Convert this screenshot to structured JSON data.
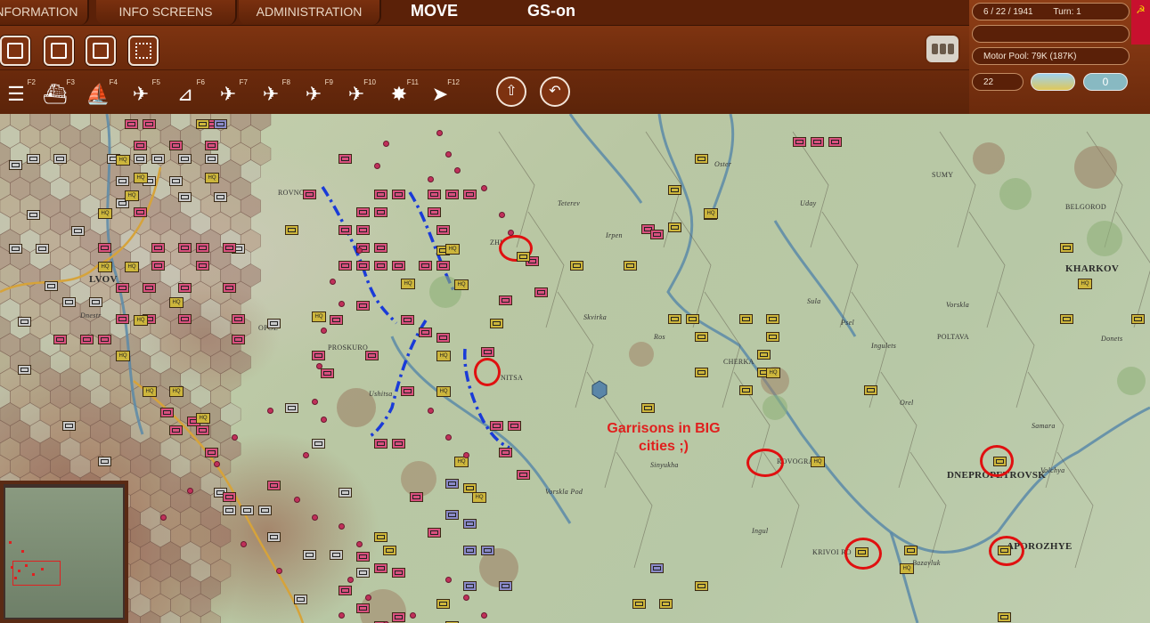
{
  "tabs": [
    {
      "label": "INFORMATION"
    },
    {
      "label": "INFO SCREENS"
    },
    {
      "label": "ADMINISTRATION"
    }
  ],
  "modes": {
    "move": "MOVE",
    "gs": "GS-on"
  },
  "toolbar_top": [
    {
      "icon": "unit-card-icon"
    },
    {
      "icon": "list-icon"
    },
    {
      "icon": "save-icon"
    },
    {
      "icon": "grid-icon"
    }
  ],
  "fkeys": [
    {
      "key": "F2",
      "icon": "rail-icon"
    },
    {
      "key": "F3",
      "icon": "battleship-icon"
    },
    {
      "key": "F4",
      "icon": "transport-ship-icon"
    },
    {
      "key": "F5",
      "icon": "air-recon-icon"
    },
    {
      "key": "F6",
      "icon": "artillery-icon"
    },
    {
      "key": "F7",
      "icon": "air-transfer-icon"
    },
    {
      "key": "F8",
      "icon": "air-interdiction-icon"
    },
    {
      "key": "F9",
      "icon": "paradrop-icon"
    },
    {
      "key": "F10",
      "icon": "air-bomb-icon"
    },
    {
      "key": "F11",
      "icon": "explosion-icon"
    },
    {
      "key": "F12",
      "icon": "end-turn-icon"
    }
  ],
  "actions": [
    {
      "icon": "upload-icon"
    },
    {
      "icon": "undo-icon"
    }
  ],
  "info": {
    "date": "6 / 22 / 1941",
    "turn": "Turn: 1",
    "blank": "",
    "motor_pool": "Motor Pool:  79K (187K)",
    "level": "22",
    "toggle_value": "0"
  },
  "colors": {
    "soviet": "#d8507e",
    "axis": "#c9c9c9",
    "allied_hq": "#cdb63c",
    "highlight": "#e01010",
    "bar": "#7a300f"
  },
  "map": {
    "towns": [
      {
        "name": "LVOV",
        "big": true
      },
      {
        "name": "ROVNO",
        "big": false
      },
      {
        "name": "PROSKURO",
        "big": false
      },
      {
        "name": "ZHI",
        "big": false
      },
      {
        "name": "NITSA",
        "big": false
      },
      {
        "name": "CHERKA",
        "big": false
      },
      {
        "name": "ROVOGRA",
        "big": false
      },
      {
        "name": "KRIVOI RO",
        "big": false
      },
      {
        "name": "DNEPROPETROVSK",
        "big": true
      },
      {
        "name": "APOROZHYE",
        "big": true
      },
      {
        "name": "POLTAVA",
        "big": false
      },
      {
        "name": "SUMY",
        "big": false
      },
      {
        "name": "BELGOROD",
        "big": false
      },
      {
        "name": "KHARKOV",
        "big": true
      },
      {
        "name": "OPOL",
        "big": false
      }
    ],
    "rivers": [
      "Oster",
      "Teterev",
      "Irpen",
      "Uday",
      "Sula",
      "Psel",
      "Vorskla",
      "Orel",
      "Samara",
      "Volchya",
      "Ros",
      "Sinyukha",
      "Ingul",
      "Bazavluk",
      "Donets",
      "Dnestr",
      "Ushitsa",
      "Vorskla Pod",
      "Skvirka",
      "Ingulets"
    ],
    "annotation": "Garrisons in BIG\ncities ;)"
  }
}
